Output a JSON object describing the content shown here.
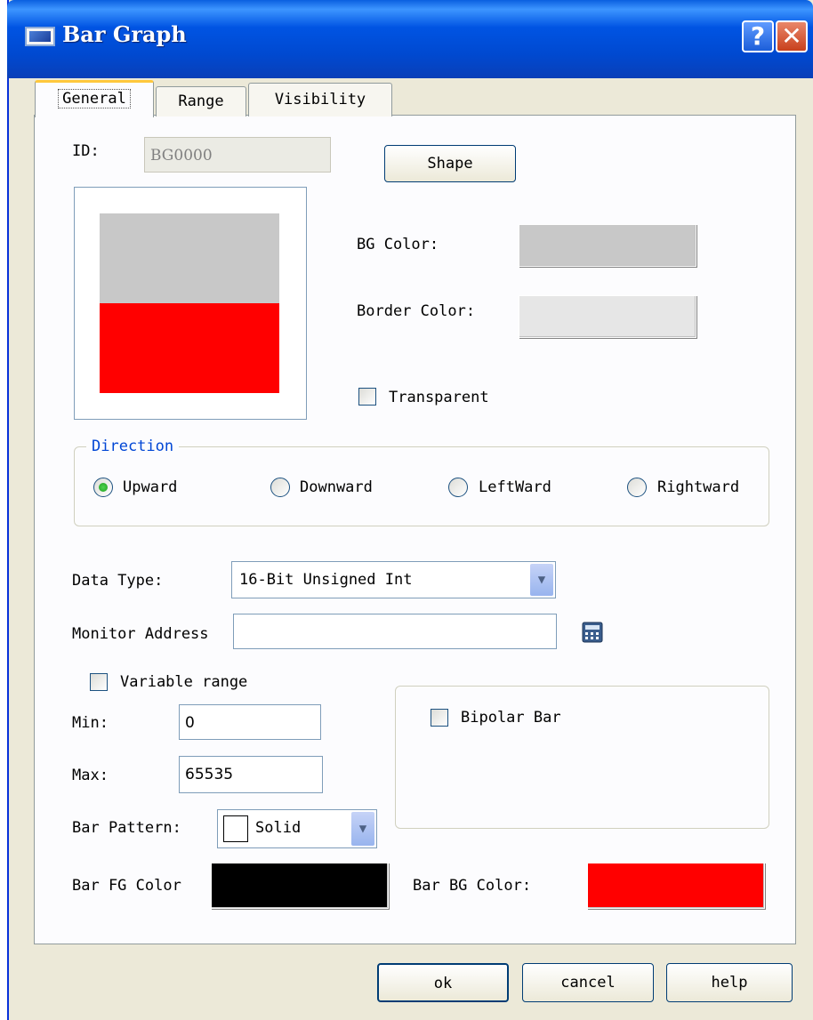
{
  "window": {
    "title": "Bar Graph",
    "help_glyph": "?",
    "close_glyph": "✕"
  },
  "tabs": [
    {
      "label": "General",
      "active": true
    },
    {
      "label": "Range"
    },
    {
      "label": "Visibility"
    }
  ],
  "general": {
    "id_label": "ID:",
    "id_value": "BG0000",
    "shape_button": "Shape",
    "preview": {
      "bg_color": "#c8c8c8",
      "fill_color": "#ff0000",
      "frame_color": "#ffffff",
      "fill_level": 0.5
    },
    "bg_color_label": "BG Color:",
    "bg_color_value": "#c8c8c8",
    "border_color_label": "Border Color:",
    "border_color_value": "#e6e6e6",
    "transparent_label": "Transparent",
    "transparent_checked": false
  },
  "direction": {
    "legend": "Direction",
    "options": [
      {
        "label": "Upward",
        "selected": true
      },
      {
        "label": "Downward",
        "selected": false
      },
      {
        "label": "LeftWard",
        "selected": false
      },
      {
        "label": "Rightward",
        "selected": false
      }
    ]
  },
  "data": {
    "data_type_label": "Data Type:",
    "data_type_value": "16-Bit Unsigned Int",
    "monitor_address_label": "Monitor Address",
    "monitor_address_value": "",
    "variable_range_label": "Variable range",
    "min_label": "Min:",
    "min_value": "0",
    "max_label": "Max:",
    "max_value": "65535",
    "bipolar_label": "Bipolar Bar",
    "bar_pattern_label": "Bar Pattern:",
    "bar_pattern_value": "Solid",
    "bar_fg_label": "Bar FG Color",
    "bar_fg_color": "#000000",
    "bar_bg_label": "Bar BG Color:",
    "bar_bg_color": "#ff0000"
  },
  "buttons": {
    "ok": "ok",
    "cancel": "cancel",
    "help": "help"
  },
  "icons": {
    "calculator": "calculator-icon",
    "dropdown": "chevron-down-icon",
    "window": "window-icon"
  }
}
